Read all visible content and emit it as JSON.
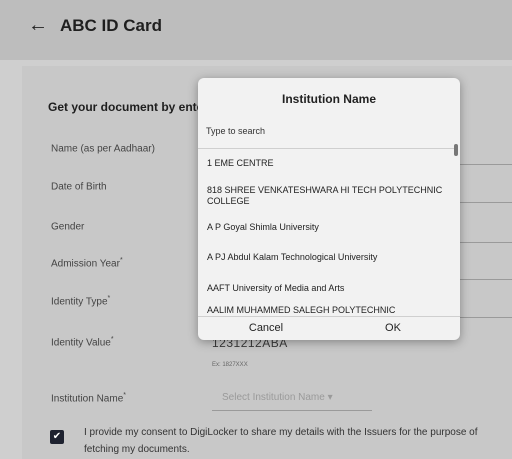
{
  "appbar": {
    "back_icon": "←",
    "title": "ABC ID Card"
  },
  "form": {
    "heading": "Get your document by entering",
    "fields": [
      {
        "label": "Name (as per Aadhaar)",
        "required": ""
      },
      {
        "label": "Date of Birth",
        "required": ""
      },
      {
        "label": "Gender",
        "required": ""
      },
      {
        "label": "Admission Year",
        "required": "*"
      },
      {
        "label": "Identity Type",
        "required": "*"
      },
      {
        "label": "Identity Value",
        "required": "*"
      },
      {
        "label": "Institution Name",
        "required": "*"
      }
    ],
    "identity_value": "1231212ABA",
    "identity_hint": "Ex: 1827XXX",
    "institution_placeholder": "Select Institution Name",
    "institution_caret": "▾",
    "consent_checked": "✔",
    "consent_text": "I provide my consent to DigiLocker to share my details with the Issuers for the purpose of fetching my documents."
  },
  "dialog": {
    "title": "Institution Name",
    "search_placeholder": "Type to search",
    "items": [
      "1 EME CENTRE",
      "818 SHREE VENKATESHWARA HI TECH POLYTECHNIC COLLEGE",
      "A P Goyal Shimla University",
      "A PJ Abdul Kalam Technological University",
      "AAFT University of Media and Arts",
      "AALIM MUHAMMED SALEGH POLYTECHNIC"
    ],
    "cancel_label": "Cancel",
    "ok_label": "OK"
  }
}
